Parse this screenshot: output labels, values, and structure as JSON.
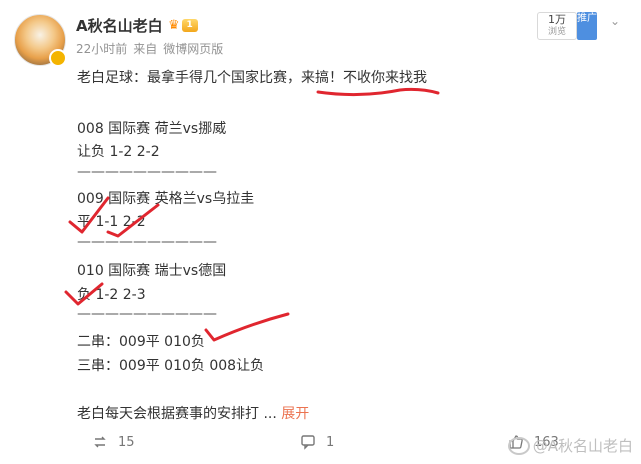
{
  "user": {
    "name": "A秋名山老白",
    "level": "1",
    "time": "22小时前",
    "source_prefix": "来自",
    "source": "微博网页版"
  },
  "header_buttons": {
    "follow_count": "1万",
    "follow_label": "浏览",
    "promote_label": "推广"
  },
  "post": {
    "intro_a": "老白足球：最拿手得几个国家比赛，",
    "intro_b": "来搞！不收你来找我",
    "m1_title": "008 国际赛 荷兰vs挪威",
    "m1_line": "让负 1-2 2-2",
    "div1": "——————————",
    "m2_title": "009 国际赛 英格兰vs乌拉圭",
    "m2_line": "平 1-1 2-2",
    "div2": "——————————",
    "m3_title": "010 国际赛 瑞士vs德国",
    "m3_line": "负 1-2 2-3",
    "div3": "——————————",
    "parlay2": "二串：009平 010负",
    "parlay3": "三串：009平 010负 008让负",
    "outro": "老白每天会根据赛事的安排打",
    "ellipsis": " ...",
    "expand": "展开"
  },
  "actions": {
    "repost_count": "15",
    "comment_count": "1",
    "like_count": "163"
  },
  "watermark": "@A秋名山老白",
  "colors": {
    "annotation": "#e0262f",
    "expand": "#eb7350",
    "promote": "#4e8fe0"
  }
}
